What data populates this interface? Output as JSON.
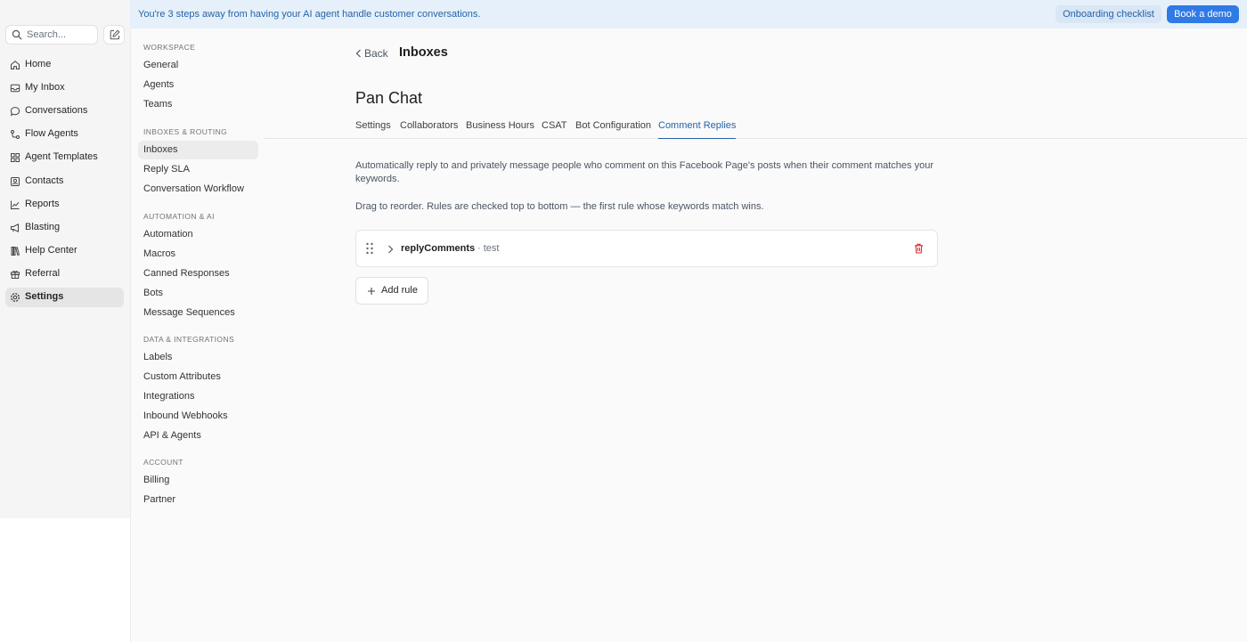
{
  "banner": {
    "message": "You're 3 steps away from having your AI agent handle customer conversations.",
    "checklist_label": "Onboarding checklist",
    "demo_label": "Book a demo"
  },
  "search": {
    "placeholder": "Search..."
  },
  "nav": {
    "items": [
      {
        "label": "Home",
        "icon": "home-icon"
      },
      {
        "label": "My Inbox",
        "icon": "inbox-icon"
      },
      {
        "label": "Conversations",
        "icon": "chat-bubble-icon"
      },
      {
        "label": "Flow Agents",
        "icon": "flow-icon"
      },
      {
        "label": "Agent Templates",
        "icon": "grid-icon"
      },
      {
        "label": "Contacts",
        "icon": "contact-card-icon"
      },
      {
        "label": "Reports",
        "icon": "line-chart-icon"
      },
      {
        "label": "Blasting",
        "icon": "megaphone-icon"
      },
      {
        "label": "Help Center",
        "icon": "book-icon"
      },
      {
        "label": "Referral",
        "icon": "gift-icon"
      },
      {
        "label": "Settings",
        "icon": "gear-icon",
        "active": true
      }
    ]
  },
  "settings_nav": {
    "workspace_heading": "WORKSPACE",
    "workspace": [
      "General",
      "Agents",
      "Teams"
    ],
    "routing_heading": "INBOXES & ROUTING",
    "routing": [
      "Inboxes",
      "Reply SLA",
      "Conversation Workflow"
    ],
    "automation_heading": "AUTOMATION & AI",
    "automation": [
      "Automation",
      "Macros",
      "Canned Responses",
      "Bots",
      "Message Sequences"
    ],
    "data_heading": "DATA & INTEGRATIONS",
    "data": [
      "Labels",
      "Custom Attributes",
      "Integrations",
      "Inbound Webhooks",
      "API & Agents"
    ],
    "account_heading": "ACCOUNT",
    "account": [
      "Billing",
      "Partner"
    ]
  },
  "header": {
    "back_label": "Back",
    "crumb_title": "Inboxes",
    "page_title": "Pan Chat"
  },
  "tabs": [
    "Settings",
    "Collaborators",
    "Business Hours",
    "CSAT",
    "Bot Configuration",
    "Comment Replies"
  ],
  "active_tab": "Comment Replies",
  "content": {
    "description": "Automatically reply to and privately message people who comment on this Facebook Page's posts when their comment matches your keywords.",
    "reorder_hint": "Drag to reorder. Rules are checked top to bottom — the first rule whose keywords match wins.",
    "rules": [
      {
        "name": "replyComments",
        "keywords": "· test"
      }
    ],
    "add_rule_label": "Add rule"
  },
  "colors": {
    "accent": "#2563a8",
    "primary_button": "#2f7ae5",
    "banner_bg": "#e6f0fa",
    "danger": "#dc2626"
  }
}
